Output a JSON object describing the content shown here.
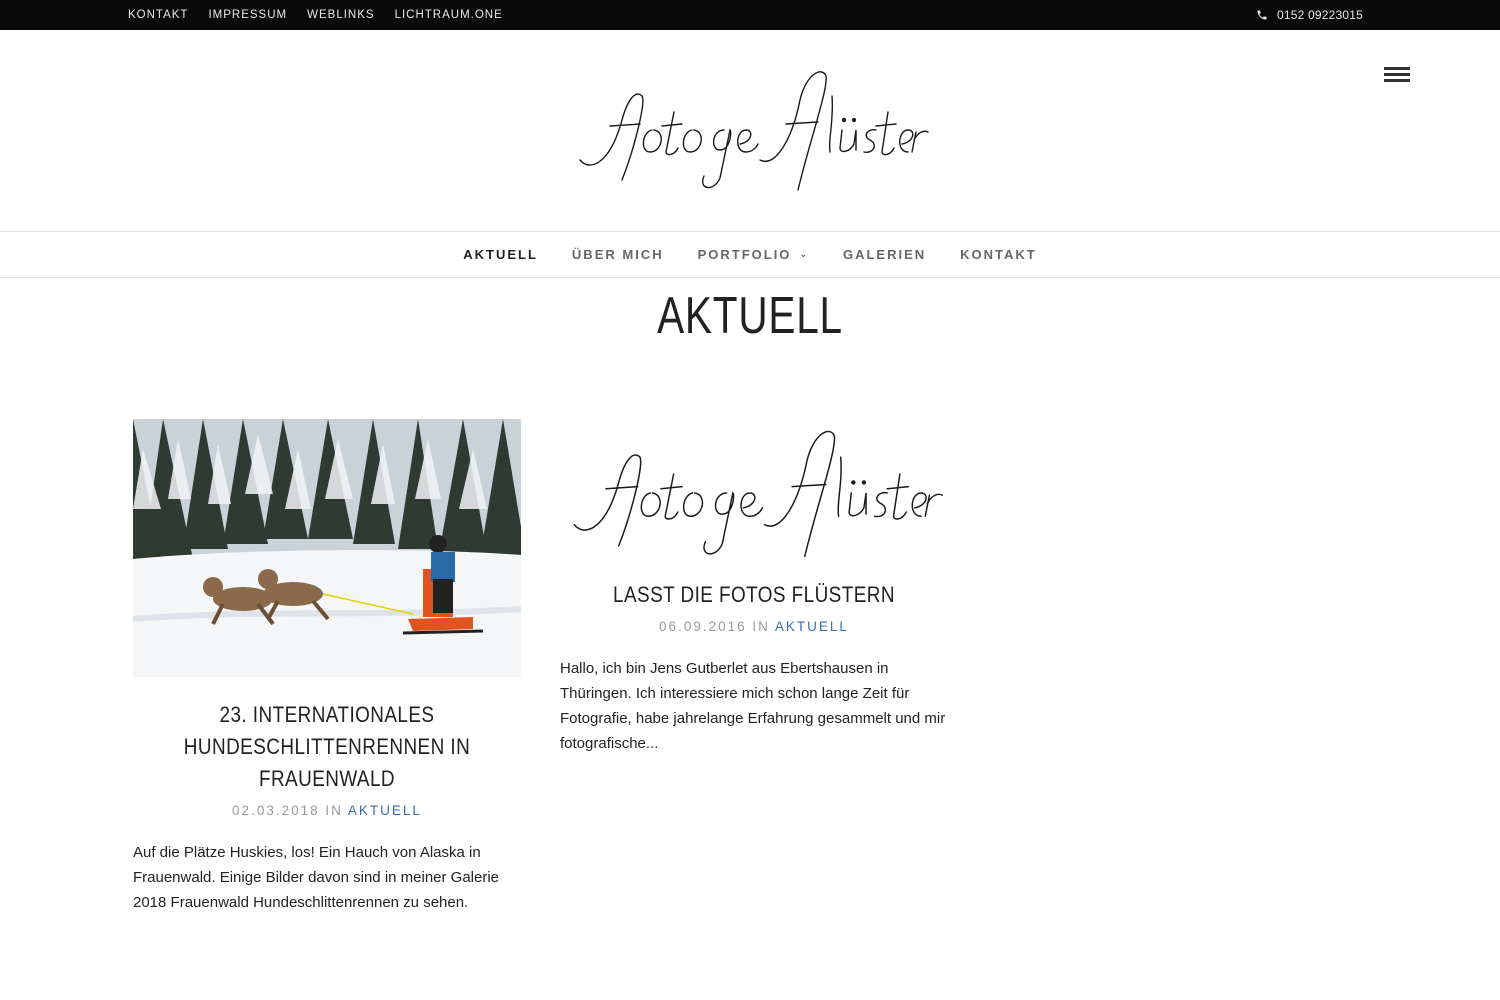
{
  "topbar": {
    "links": [
      "KONTAKT",
      "IMPRESSUM",
      "WEBLINKS",
      "LICHTRAUM.ONE"
    ],
    "phone": "0152 09223015"
  },
  "header": {
    "logo_text": "fotogeflüster"
  },
  "nav": {
    "items": [
      {
        "label": "AKTUELL",
        "active": true
      },
      {
        "label": "ÜBER MICH"
      },
      {
        "label": "PORTFOLIO",
        "has_dropdown": true
      },
      {
        "label": "GALERIEN"
      },
      {
        "label": "KONTAKT"
      }
    ]
  },
  "page": {
    "title": "AKTUELL"
  },
  "posts": [
    {
      "title": "23. Internationales Hundeschlittenrennen in Frauenwald",
      "date": "02.03.2018",
      "in_label": "IN",
      "category": "AKTUELL",
      "excerpt": "Auf die Plätze Huskies, los! Ein Hauch von Alaska in Frauenwald. Einige Bilder davon sind in meiner Galerie 2018 Frauenwald Hundeschlittenrennen zu sehen."
    },
    {
      "title": "Lasst die Fotos flüstern",
      "date": "06.09.2016",
      "in_label": "IN",
      "category": "AKTUELL",
      "excerpt": "Hallo, ich bin Jens Gutberlet aus Ebertshausen in Thüringen. Ich interessiere mich schon lange Zeit für Fotografie, habe jahrelange Erfahrung gesammelt und mir fotografische..."
    }
  ],
  "colors": {
    "topbar_bg": "#0a0a0a",
    "accent_link": "#3a6eb5",
    "text": "#222222"
  }
}
